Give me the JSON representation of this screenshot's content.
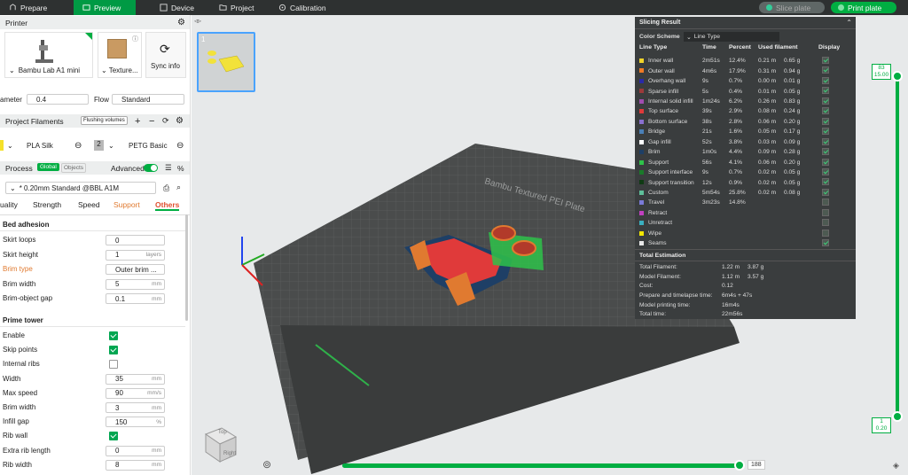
{
  "tabs": [
    {
      "label": "Prepare"
    },
    {
      "label": "Preview"
    },
    {
      "label": "Device"
    },
    {
      "label": "Project"
    },
    {
      "label": "Calibration"
    }
  ],
  "top": {
    "slice_label": "Slice plate",
    "print_label": "Print plate"
  },
  "printer": {
    "header": "Printer",
    "name": "Bambu Lab A1 mini",
    "plate": "Texture...",
    "sync": "Sync info",
    "diameter_label": "ameter",
    "diameter_value": "0.4",
    "flow_label": "Flow",
    "flow_value": "Standard"
  },
  "filaments": {
    "header": "Project Filaments",
    "flushing": "Flushing volumes",
    "items": [
      {
        "num": "",
        "name": "PLA Silk",
        "color": "#f5e12a"
      },
      {
        "num": "2",
        "name": "PETG Basic",
        "color": "#b8b8b8"
      }
    ]
  },
  "process": {
    "header": "Process",
    "global": "Global",
    "objects": "Objects",
    "advanced": "Advanced",
    "profile": "* 0.20mm Standard @BBL A1M",
    "tabs": [
      "uality",
      "Strength",
      "Speed",
      "Support",
      "Others"
    ]
  },
  "bed_adhesion": {
    "title": "Bed adhesion",
    "rows": [
      {
        "label": "Skirt loops",
        "value": "0",
        "unit": ""
      },
      {
        "label": "Skirt height",
        "value": "1",
        "unit": "layers"
      },
      {
        "label": "Brim type",
        "value": "Outer brim ...",
        "unit": ""
      },
      {
        "label": "Brim width",
        "value": "5",
        "unit": "mm"
      },
      {
        "label": "Brim-object gap",
        "value": "0.1",
        "unit": "mm"
      }
    ]
  },
  "prime_tower": {
    "title": "Prime tower",
    "rows": [
      {
        "label": "Enable",
        "type": "check",
        "on": true
      },
      {
        "label": "Skip points",
        "type": "check",
        "on": true
      },
      {
        "label": "Internal ribs",
        "type": "check",
        "on": false
      },
      {
        "label": "Width",
        "value": "35",
        "unit": "mm"
      },
      {
        "label": "Max speed",
        "value": "90",
        "unit": "mm/s"
      },
      {
        "label": "Brim width",
        "value": "3",
        "unit": "mm"
      },
      {
        "label": "Infill gap",
        "value": "150",
        "unit": "%"
      },
      {
        "label": "Rib wall",
        "type": "check",
        "on": true
      },
      {
        "label": "Extra rib length",
        "value": "0",
        "unit": "mm"
      },
      {
        "label": "Rib width",
        "value": "8",
        "unit": "mm"
      }
    ]
  },
  "thumb": {
    "num": "1"
  },
  "result": {
    "title": "Slicing Result",
    "scheme_label": "Color Scheme",
    "scheme_value": "Line Type",
    "cols": [
      "Line Type",
      "Time",
      "Percent",
      "Used filament",
      "Display"
    ],
    "rows": [
      {
        "name": "Inner wall",
        "color": "#f2d42a",
        "time": "2m51s",
        "pct": "12.4%",
        "len": "0.21 m",
        "wt": "0.65 g",
        "on": true
      },
      {
        "name": "Outer wall",
        "color": "#f07a25",
        "time": "4m6s",
        "pct": "17.9%",
        "len": "0.31 m",
        "wt": "0.94 g",
        "on": true
      },
      {
        "name": "Overhang wall",
        "color": "#2a2aa8",
        "time": "9s",
        "pct": "0.7%",
        "len": "0.00 m",
        "wt": "0.01 g",
        "on": true
      },
      {
        "name": "Sparse infill",
        "color": "#9c3a3a",
        "time": "5s",
        "pct": "0.4%",
        "len": "0.01 m",
        "wt": "0.05 g",
        "on": true
      },
      {
        "name": "Internal solid infill",
        "color": "#a04db0",
        "time": "1m24s",
        "pct": "6.2%",
        "len": "0.26 m",
        "wt": "0.83 g",
        "on": true
      },
      {
        "name": "Top surface",
        "color": "#e03a3a",
        "time": "39s",
        "pct": "2.9%",
        "len": "0.08 m",
        "wt": "0.24 g",
        "on": true
      },
      {
        "name": "Bottom surface",
        "color": "#8a70d0",
        "time": "38s",
        "pct": "2.8%",
        "len": "0.06 m",
        "wt": "0.20 g",
        "on": true
      },
      {
        "name": "Bridge",
        "color": "#4a80b8",
        "time": "21s",
        "pct": "1.6%",
        "len": "0.05 m",
        "wt": "0.17 g",
        "on": true
      },
      {
        "name": "Gap infill",
        "color": "#ffffff",
        "time": "52s",
        "pct": "3.8%",
        "len": "0.03 m",
        "wt": "0.09 g",
        "on": true
      },
      {
        "name": "Brim",
        "color": "#1e3f66",
        "time": "1m0s",
        "pct": "4.4%",
        "len": "0.09 m",
        "wt": "0.28 g",
        "on": true
      },
      {
        "name": "Support",
        "color": "#2ec24a",
        "time": "56s",
        "pct": "4.1%",
        "len": "0.06 m",
        "wt": "0.20 g",
        "on": true
      },
      {
        "name": "Support interface",
        "color": "#1a7a2a",
        "time": "9s",
        "pct": "0.7%",
        "len": "0.02 m",
        "wt": "0.05 g",
        "on": true
      },
      {
        "name": "Support transition",
        "color": "#0f3a14",
        "time": "12s",
        "pct": "0.9%",
        "len": "0.02 m",
        "wt": "0.05 g",
        "on": true
      },
      {
        "name": "Custom",
        "color": "#5ec09a",
        "time": "5m54s",
        "pct": "25.8%",
        "len": "0.02 m",
        "wt": "0.08 g",
        "on": true
      },
      {
        "name": "Travel",
        "color": "#7a7ad8",
        "time": "3m23s",
        "pct": "14.8%",
        "len": "",
        "wt": "",
        "on": false
      },
      {
        "name": "Retract",
        "color": "#c040c0",
        "time": "",
        "pct": "",
        "len": "",
        "wt": "",
        "on": false
      },
      {
        "name": "Unretract",
        "color": "#3ab0c0",
        "time": "",
        "pct": "",
        "len": "",
        "wt": "",
        "on": false
      },
      {
        "name": "Wipe",
        "color": "#f2e600",
        "time": "",
        "pct": "",
        "len": "",
        "wt": "",
        "on": false
      },
      {
        "name": "Seams",
        "color": "#e8e8e8",
        "time": "",
        "pct": "",
        "len": "",
        "wt": "",
        "on": true
      }
    ],
    "total_title": "Total Estimation",
    "totals": [
      {
        "label": "Total Filament:",
        "a": "1.22 m",
        "b": "3.87 g"
      },
      {
        "label": "Model Filament:",
        "a": "1.12 m",
        "b": "3.57 g"
      },
      {
        "label": "Cost:",
        "a": "0.12",
        "b": ""
      },
      {
        "label": "Prepare and timelapse time:",
        "a": "6m4s + 47s",
        "b": ""
      },
      {
        "label": "Model printing time:",
        "a": "16m4s",
        "b": ""
      },
      {
        "label": "Total time:",
        "a": "22m56s",
        "b": ""
      }
    ]
  },
  "vslider": {
    "top_layer": "83",
    "top_height": "15.00",
    "bottom_layer": "1",
    "bottom_height": "0.20"
  },
  "hslider": {
    "value": "188"
  },
  "plate_text": "Bambu Textured PEI Plate",
  "cube": {
    "top": "Top",
    "left": "Front",
    "right": "Right"
  },
  "colors": {
    "accent": "#00ae42",
    "dark": "#2e3131"
  }
}
